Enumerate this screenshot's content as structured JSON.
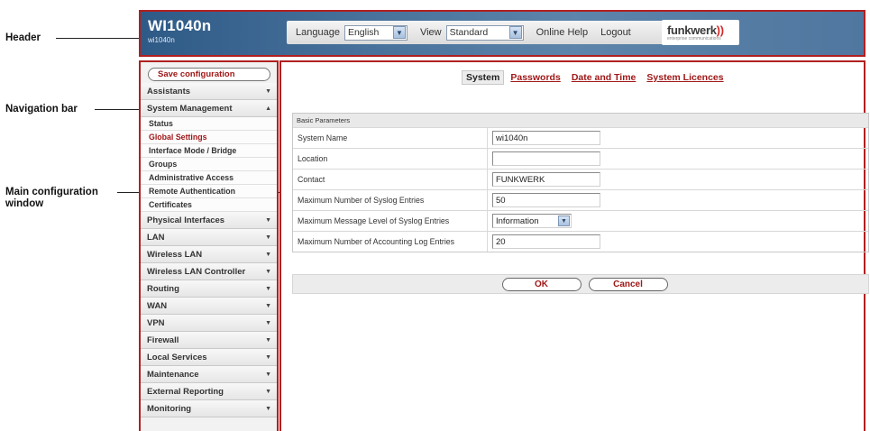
{
  "callouts": {
    "header": "Header",
    "navigation": "Navigation bar",
    "main": "Main configuration window"
  },
  "header": {
    "title": "WI1040n",
    "subtitle": "wi1040n",
    "language_label": "Language",
    "language_value": "English",
    "view_label": "View",
    "view_value": "Standard",
    "online_help": "Online Help",
    "logout": "Logout",
    "brand": "funkwerk",
    "brand_tagline": "enterprise communications"
  },
  "nav": {
    "save_configuration": "Save configuration",
    "items": [
      {
        "label": "Assistants",
        "arrow": "▼"
      },
      {
        "label": "System Management",
        "arrow": "▲"
      }
    ],
    "sub_items": [
      {
        "label": "Status"
      },
      {
        "label": "Global Settings"
      },
      {
        "label": "Interface Mode / Bridge"
      },
      {
        "label": "Groups"
      },
      {
        "label": "Administrative Access"
      },
      {
        "label": "Remote Authentication"
      },
      {
        "label": "Certificates"
      }
    ],
    "items_after": [
      {
        "label": "Physical Interfaces",
        "arrow": "▼"
      },
      {
        "label": "LAN",
        "arrow": "▼"
      },
      {
        "label": "Wireless LAN",
        "arrow": "▼"
      },
      {
        "label": "Wireless LAN Controller",
        "arrow": "▼"
      },
      {
        "label": "Routing",
        "arrow": "▼"
      },
      {
        "label": "WAN",
        "arrow": "▼"
      },
      {
        "label": "VPN",
        "arrow": "▼"
      },
      {
        "label": "Firewall",
        "arrow": "▼"
      },
      {
        "label": "Local Services",
        "arrow": "▼"
      },
      {
        "label": "Maintenance",
        "arrow": "▼"
      },
      {
        "label": "External Reporting",
        "arrow": "▼"
      },
      {
        "label": "Monitoring",
        "arrow": "▼"
      }
    ]
  },
  "main": {
    "tabs": [
      {
        "label": "System"
      },
      {
        "label": "Passwords"
      },
      {
        "label": "Date and Time"
      },
      {
        "label": "System Licences"
      }
    ],
    "section_title": "Basic Parameters",
    "rows": [
      {
        "label": "System Name",
        "value": "wi1040n"
      },
      {
        "label": "Location",
        "value": ""
      },
      {
        "label": "Contact",
        "value": "FUNKWERK"
      },
      {
        "label": "Maximum Number of Syslog Entries",
        "value": "50"
      },
      {
        "label": "Maximum Message Level of Syslog Entries",
        "value": "Information"
      },
      {
        "label": "Maximum Number of Accounting Log Entries",
        "value": "20"
      }
    ],
    "ok": "OK",
    "cancel": "Cancel"
  }
}
